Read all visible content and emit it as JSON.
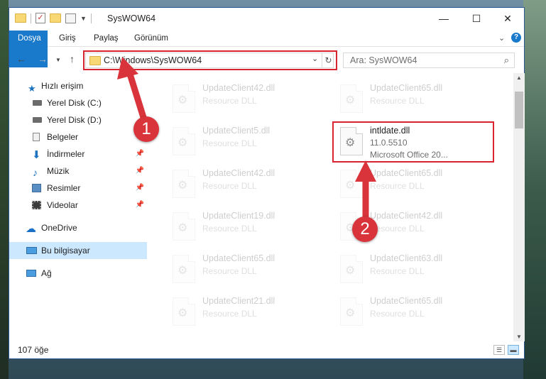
{
  "window": {
    "title": "SysWOW64",
    "minimize_glyph": "—",
    "maximize_glyph": "☐",
    "close_glyph": "✕"
  },
  "ribbon": {
    "tabs": [
      "Dosya",
      "Giriş",
      "Paylaş",
      "Görünüm"
    ],
    "help_glyph": "?"
  },
  "address_bar": {
    "path": "C:\\Windows\\SysWOW64"
  },
  "search": {
    "placeholder": "Ara: SysWOW64"
  },
  "sidebar": {
    "items": [
      {
        "label": "Hızlı erişim",
        "icon": "star-icon"
      },
      {
        "label": "Yerel Disk (C:)",
        "icon": "drive-icon"
      },
      {
        "label": "Yerel Disk (D:)",
        "icon": "drive-icon"
      },
      {
        "label": "Belgeler",
        "icon": "documents-icon"
      },
      {
        "label": "İndirmeler",
        "icon": "download-icon"
      },
      {
        "label": "Müzik",
        "icon": "music-icon"
      },
      {
        "label": "Resimler",
        "icon": "pictures-icon"
      },
      {
        "label": "Videolar",
        "icon": "video-icon"
      },
      {
        "label": "OneDrive",
        "icon": "cloud-icon"
      },
      {
        "label": "Bu bilgisayar",
        "icon": "computer-icon"
      },
      {
        "label": "Ağ",
        "icon": "network-icon"
      }
    ]
  },
  "files": [
    {
      "name": "UpdateClient42.dll",
      "line1": "Resource DLL"
    },
    {
      "name": "UpdateClient65.dll",
      "line1": "Resource DLL"
    },
    {
      "name": "UpdateClient5.dll",
      "line1": "Resource DLL"
    },
    {
      "name": "intldate.dll",
      "line1": "11.0.5510",
      "line2": "Microsoft Office 20..."
    },
    {
      "name": "UpdateClient42.dll",
      "line1": "Resource DLL"
    },
    {
      "name": "UpdateClient65.dll",
      "line1": "Resource DLL"
    },
    {
      "name": "UpdateClient19.dll",
      "line1": "Resource DLL"
    },
    {
      "name": "UpdateClient42.dll",
      "line1": "Resource DLL"
    },
    {
      "name": "UpdateClient65.dll",
      "line1": "Resource DLL"
    },
    {
      "name": "UpdateClient63.dll",
      "line1": "Resource DLL"
    },
    {
      "name": "UpdateClient21.dll",
      "line1": "Resource DLL"
    },
    {
      "name": "UpdateClient65.dll",
      "line1": "Resource DLL"
    }
  ],
  "status_bar": {
    "item_count": "107 öğe"
  },
  "annotations": {
    "step1": "1",
    "step2": "2",
    "highlight_color": "#d9232e"
  }
}
